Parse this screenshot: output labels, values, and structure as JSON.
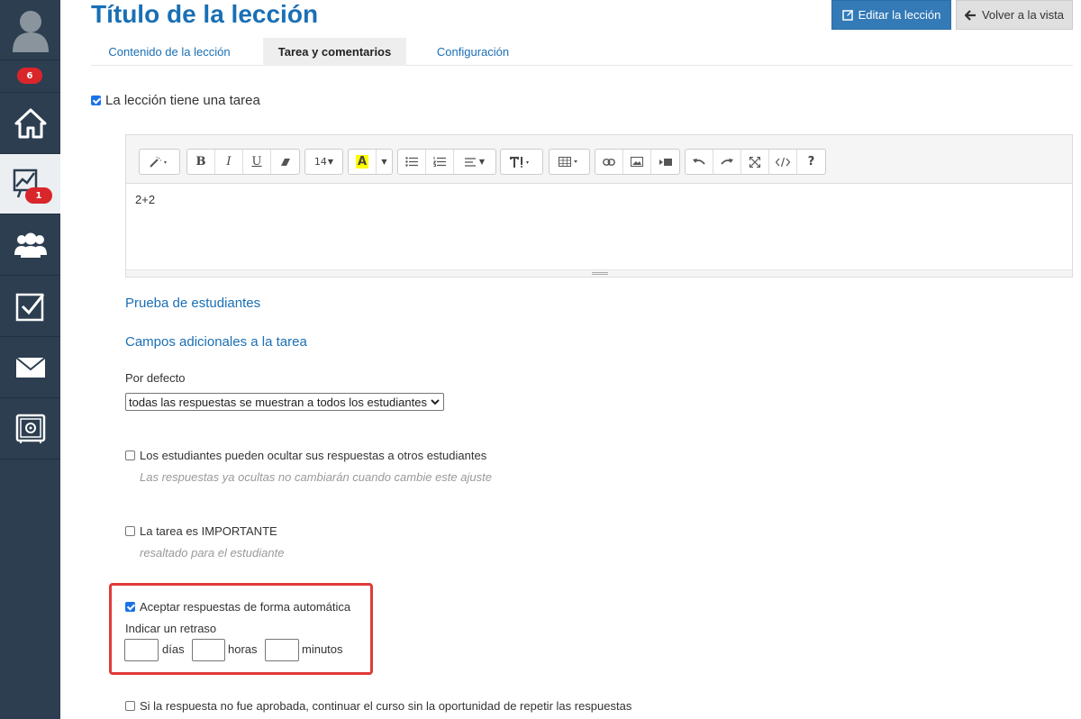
{
  "sidebar": {
    "items": [
      {
        "icon": "user-avatar-icon"
      },
      {
        "badge": "6"
      },
      {
        "icon": "home-icon"
      },
      {
        "icon": "chart-presentation-icon",
        "badge": "1"
      },
      {
        "icon": "users-group-icon"
      },
      {
        "icon": "checkbox-task-icon"
      },
      {
        "icon": "mail-icon"
      },
      {
        "icon": "safe-settings-icon"
      }
    ]
  },
  "header": {
    "title": "Título de la lección",
    "edit_button": "Editar la lección",
    "back_button": "Volver a la vista"
  },
  "tabs": [
    "Contenido de la lección",
    "Tarea y comentarios",
    "Configuración"
  ],
  "active_tab": "Tarea y comentarios",
  "has_task": {
    "label": "La lección tiene una tarea",
    "checked": true
  },
  "editor": {
    "font_size": "14",
    "content": "2+2",
    "toolbar_labels": {
      "bold": "B",
      "italic": "I",
      "underline": "U",
      "help": "?"
    }
  },
  "sections": {
    "student_test": "Prueba de estudiantes",
    "additional_fields": "Campos adicionales a la tarea"
  },
  "default": {
    "label": "Por defecto",
    "selected": "todas las respuestas se muestran a todos los estudiantes"
  },
  "options": [
    {
      "label": "Los estudiantes pueden ocultar sus respuestas a otros estudiantes",
      "hint": "Las respuestas ya ocultas no cambiarán cuando cambie este ajuste",
      "checked": false
    },
    {
      "label": "La tarea es IMPORTANTE",
      "hint": "resaltado para el estudiante",
      "checked": false
    },
    {
      "label": "Aceptar respuestas de forma automática",
      "checked": true
    },
    {
      "label": "Si la respuesta no fue aprobada, continuar el curso sin la oportunidad de repetir las respuestas",
      "checked": false
    }
  ],
  "delay": {
    "label": "Indicar un retraso",
    "days_unit": "días",
    "hours_unit": "horas",
    "minutes_unit": "minutos",
    "days_value": "",
    "hours_value": "",
    "minutes_value": ""
  },
  "colors": {
    "sidebar": "#2c3e50",
    "accent": "#1a6fb5",
    "badge": "#d9262b",
    "highlight": "#e03a3a"
  }
}
